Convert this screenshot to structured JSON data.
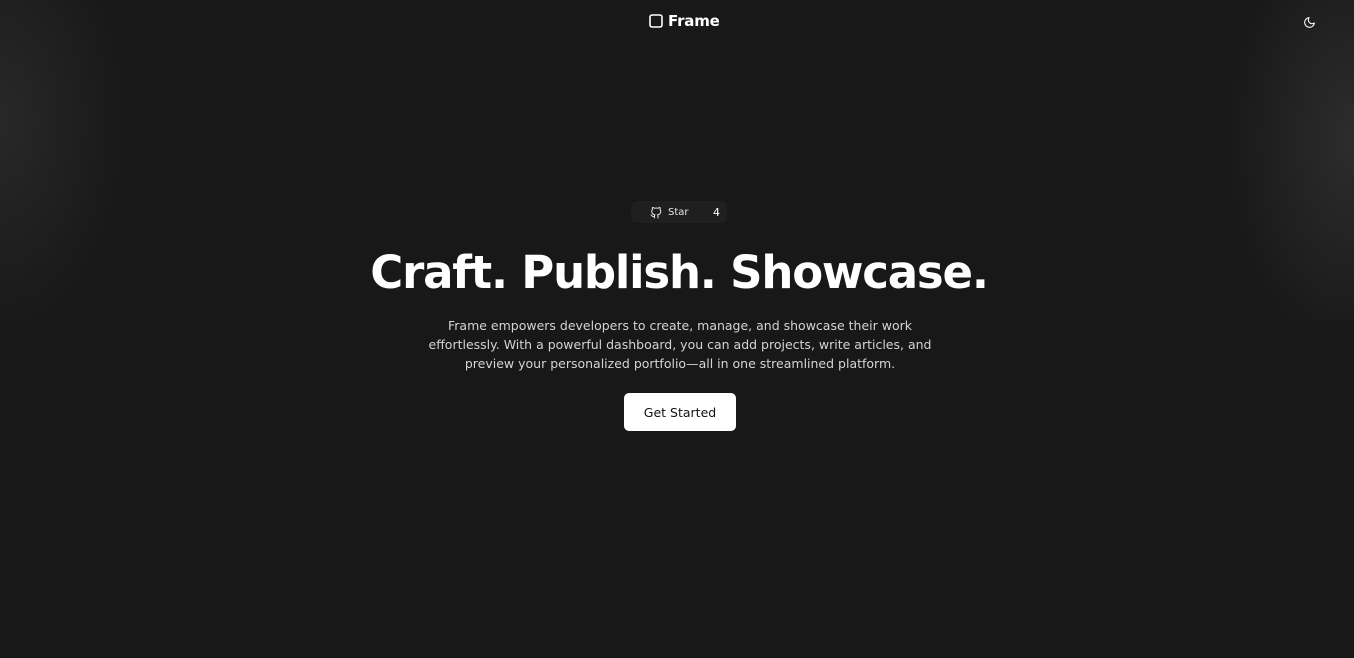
{
  "header": {
    "brand_name": "Frame",
    "brand_icon": "square-icon",
    "theme_toggle_icon": "moon-icon"
  },
  "github_badge": {
    "icon": "github-icon",
    "label": "Star",
    "count": "4"
  },
  "hero": {
    "headline": "Craft. Publish. Showcase.",
    "description": "Frame empowers developers to create, manage, and showcase their work effortlessly. With a powerful dashboard, you can add projects, write articles, and preview your personalized portfolio—all in one streamlined platform.",
    "cta_label": "Get Started"
  },
  "colors": {
    "background": "#181818",
    "text": "#ffffff",
    "muted_text": "#d4d4d4",
    "cta_background": "#ffffff",
    "cta_text": "#111111"
  }
}
